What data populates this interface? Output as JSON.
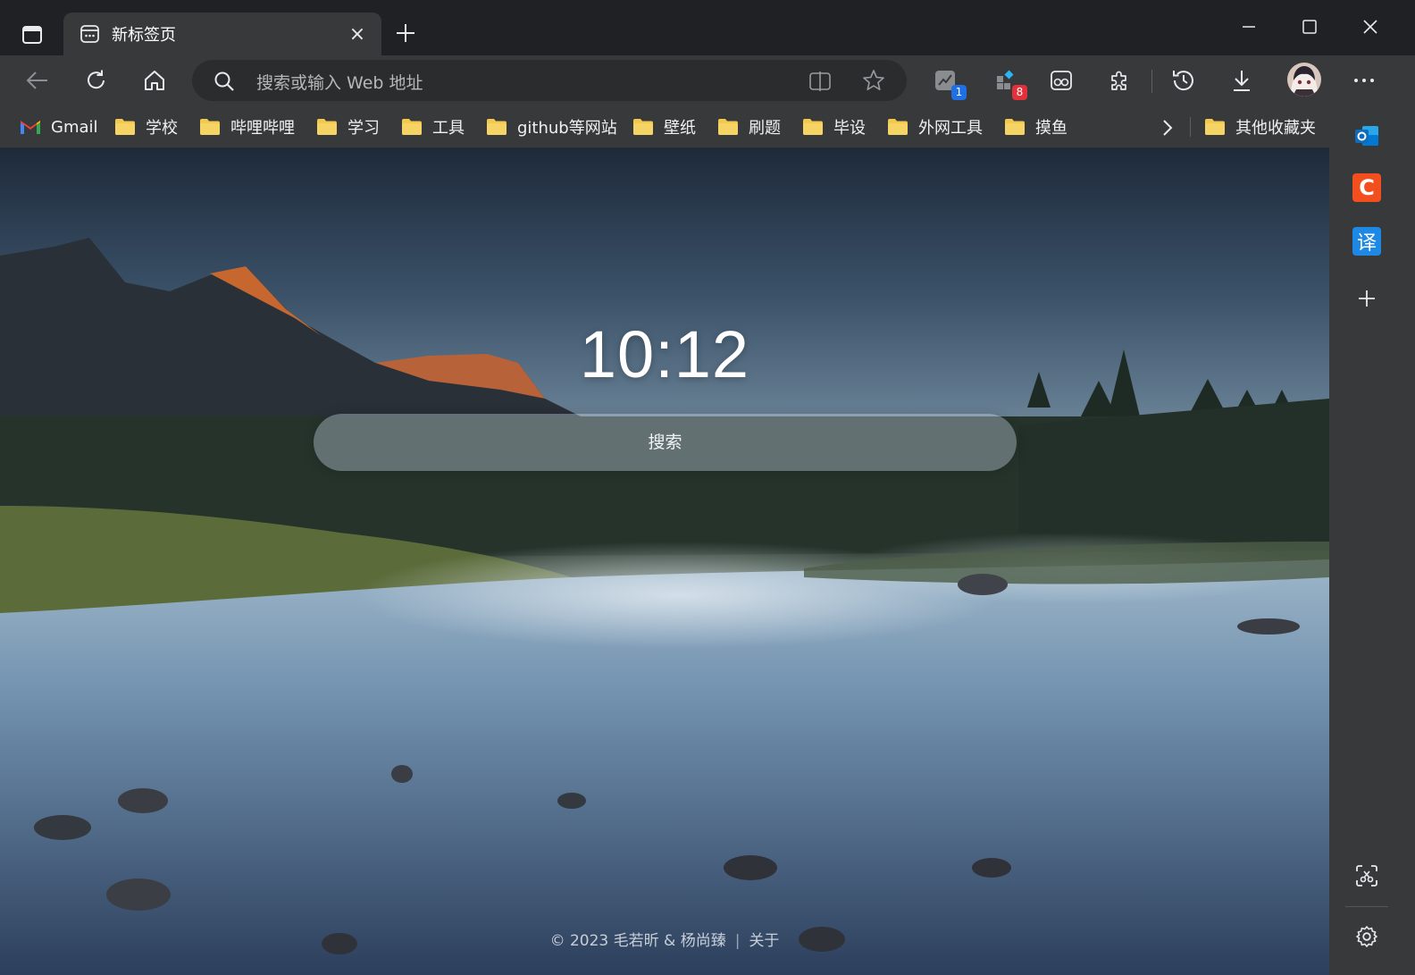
{
  "tab": {
    "title": "新标签页",
    "close_glyph": "×"
  },
  "omnibox": {
    "placeholder": "搜索或输入 Web 地址"
  },
  "extensions": [
    {
      "name": "extension-1",
      "badge": "1",
      "badge_color": "#1f6fe5"
    },
    {
      "name": "extension-2",
      "badge": "8",
      "badge_color": "#e2313b"
    }
  ],
  "bookmarks": {
    "items": [
      {
        "label": "Gmail",
        "icon": "gmail-icon"
      },
      {
        "label": "学校",
        "icon": "folder-icon"
      },
      {
        "label": "哔哩哔哩",
        "icon": "folder-icon"
      },
      {
        "label": "学习",
        "icon": "folder-icon"
      },
      {
        "label": "工具",
        "icon": "folder-icon"
      },
      {
        "label": "github等网站",
        "icon": "folder-icon"
      },
      {
        "label": "壁纸",
        "icon": "folder-icon"
      },
      {
        "label": "刷题",
        "icon": "folder-icon"
      },
      {
        "label": "毕设",
        "icon": "folder-icon"
      },
      {
        "label": "外网工具",
        "icon": "folder-icon"
      },
      {
        "label": "摸鱼",
        "icon": "folder-icon"
      }
    ],
    "other": "其他收藏夹"
  },
  "sidebar": {
    "translate_glyph": "译",
    "c_glyph": "C"
  },
  "page": {
    "time": "10:12",
    "search_placeholder": "搜索",
    "footer_copyright": "© 2023 毛若昕 & 杨尚臻",
    "footer_divider": "|",
    "footer_about": "关于"
  },
  "colors": {
    "folder": "#f2c94c",
    "outlook": "#0f6cbd",
    "c_app": "#f24e1e",
    "translate": "#1e88e5"
  }
}
